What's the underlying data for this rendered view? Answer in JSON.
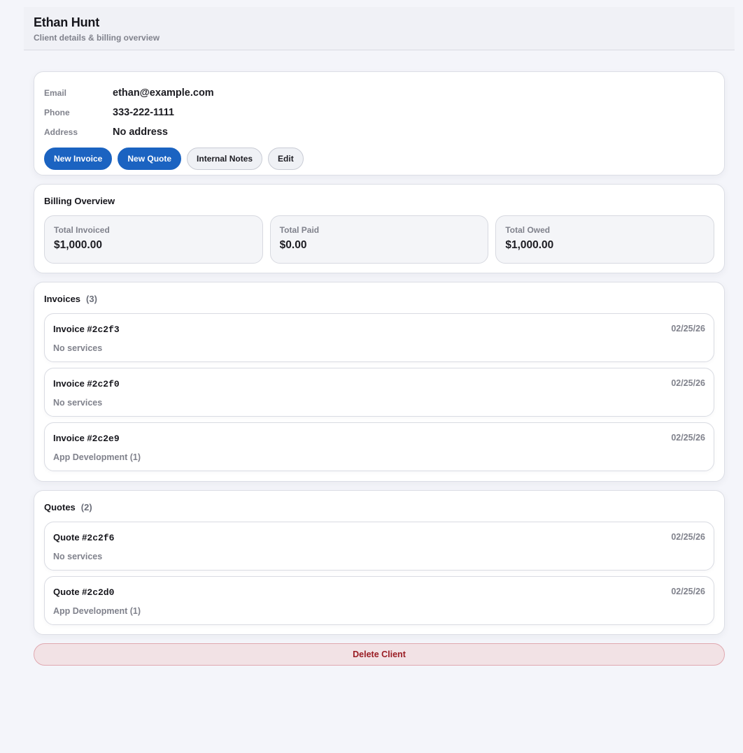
{
  "header": {
    "title": "Ethan Hunt",
    "subtitle": "Client details & billing overview"
  },
  "contact": {
    "fields": [
      {
        "label": "Email",
        "value": "ethan@example.com"
      },
      {
        "label": "Phone",
        "value": "333-222-1111"
      },
      {
        "label": "Address",
        "value": "No address"
      }
    ],
    "actions": {
      "new_invoice": "New Invoice",
      "new_quote": "New Quote",
      "internal_notes": "Internal Notes",
      "edit": "Edit"
    }
  },
  "billing": {
    "title": "Billing Overview",
    "stats": [
      {
        "label": "Total Invoiced",
        "value": "$1,000.00"
      },
      {
        "label": "Total Paid",
        "value": "$0.00"
      },
      {
        "label": "Total Owed",
        "value": "$1,000.00"
      }
    ]
  },
  "invoices": {
    "title": "Invoices",
    "count": "(3)",
    "items": [
      {
        "prefix": "Invoice #",
        "id": "2c2f3",
        "date": "02/25/26",
        "services": "No services"
      },
      {
        "prefix": "Invoice #",
        "id": "2c2f0",
        "date": "02/25/26",
        "services": "No services"
      },
      {
        "prefix": "Invoice #",
        "id": "2c2e9",
        "date": "02/25/26",
        "services": "App Development (1)"
      }
    ]
  },
  "quotes": {
    "title": "Quotes",
    "count": "(2)",
    "items": [
      {
        "prefix": "Quote #",
        "id": "2c2f6",
        "date": "02/25/26",
        "services": "No services"
      },
      {
        "prefix": "Quote #",
        "id": "2c2d0",
        "date": "02/25/26",
        "services": "App Development (1)"
      }
    ]
  },
  "delete_label": "Delete Client",
  "colors": {
    "primary": "#1b63c1",
    "danger": "#9a1d24",
    "danger_bg": "#f2e2e5",
    "background": "#f4f5fa"
  }
}
